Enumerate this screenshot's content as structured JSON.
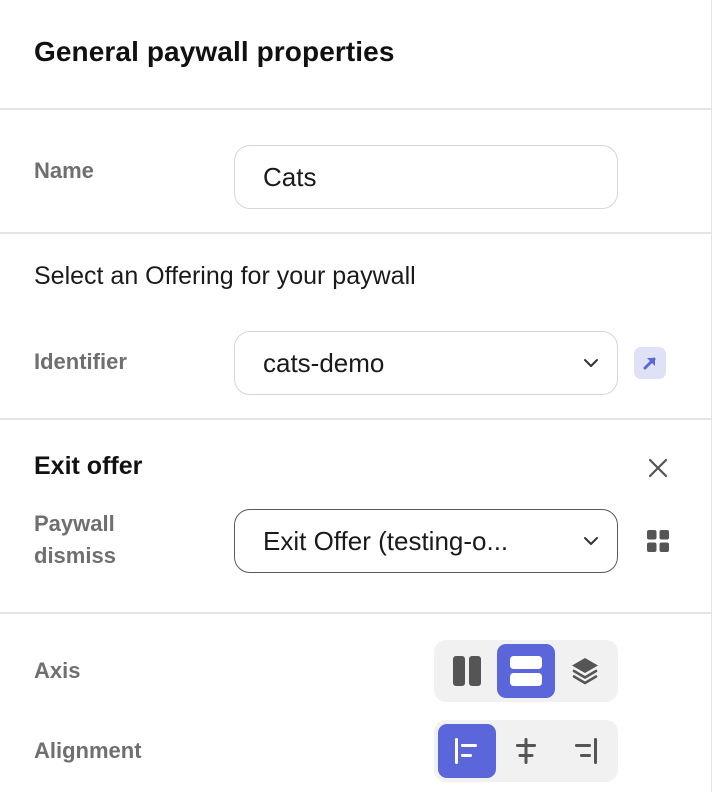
{
  "header": {
    "title": "General paywall properties"
  },
  "name_field": {
    "label": "Name",
    "value": "Cats"
  },
  "offering": {
    "heading": "Select an Offering for your paywall",
    "identifier_label": "Identifier",
    "identifier_value": "cats-demo",
    "open_icon": "arrow-up-right-icon"
  },
  "exit_offer": {
    "heading": "Exit offer",
    "close_icon": "close-icon",
    "dismiss_label_line1": "Paywall",
    "dismiss_label_line2": "dismiss",
    "dismiss_value": "Exit Offer (testing-o...",
    "grid_icon": "grid-icon"
  },
  "layout": {
    "axis_label": "Axis",
    "axis_options": [
      "vertical-columns-icon",
      "horizontal-rows-icon",
      "layers-stack-icon"
    ],
    "axis_selected": 1,
    "alignment_label": "Alignment",
    "alignment_options": [
      "align-left-icon",
      "align-center-icon",
      "align-right-icon"
    ],
    "alignment_selected": 0
  },
  "colors": {
    "accent": "#5a66d9",
    "accent_light": "#dfe2f7",
    "label": "#6f6f6f",
    "icon": "#555555"
  }
}
